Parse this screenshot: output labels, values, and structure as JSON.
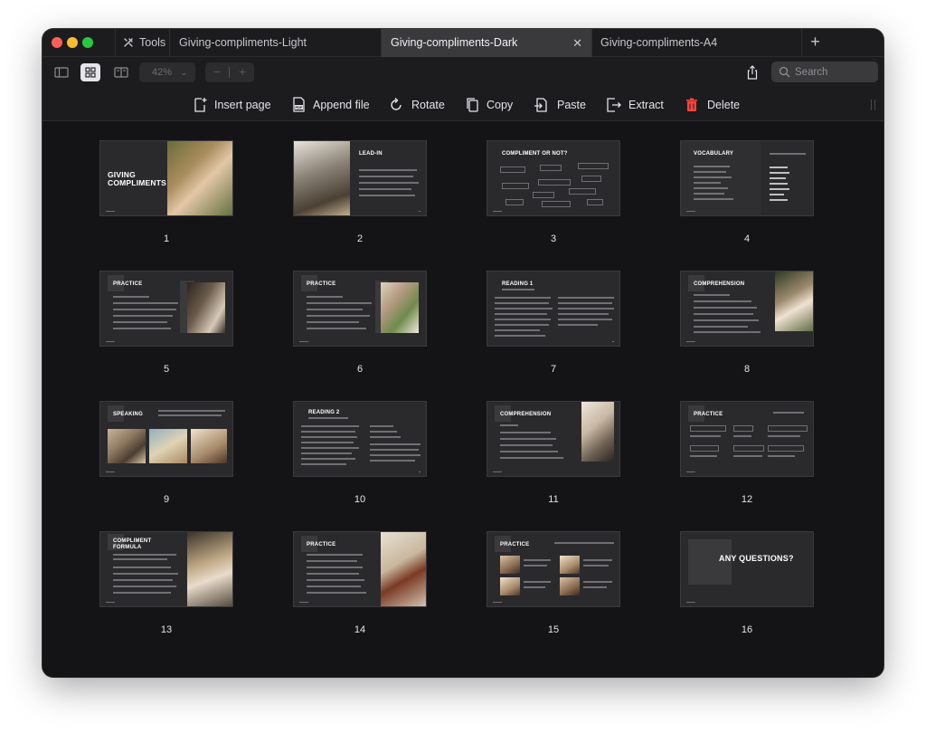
{
  "tabs": {
    "tools_label": "Tools",
    "open": [
      {
        "title": "Giving-compliments-Light",
        "active": false
      },
      {
        "title": "Giving-compliments-Dark",
        "active": true
      },
      {
        "title": "Giving-compliments-A4",
        "active": false
      }
    ],
    "close_glyph": "✕",
    "new_tab_glyph": "+"
  },
  "toolbar": {
    "zoom_value": "42%",
    "zoom_minus": "−",
    "zoom_plus": "+",
    "search_placeholder": "Search"
  },
  "actions": {
    "insert_page": "Insert page",
    "append_file": "Append file",
    "rotate": "Rotate",
    "copy": "Copy",
    "paste": "Paste",
    "extract": "Extract",
    "delete": "Delete"
  },
  "pages": [
    {
      "number": "1",
      "title": "GIVING COMPLIMENTS"
    },
    {
      "number": "2",
      "title": "LEAD-IN"
    },
    {
      "number": "3",
      "title": "COMPLIMENT OR NOT?"
    },
    {
      "number": "4",
      "title": "VOCABULARY"
    },
    {
      "number": "5",
      "title": "PRACTICE"
    },
    {
      "number": "6",
      "title": "PRACTICE"
    },
    {
      "number": "7",
      "title": "READING 1"
    },
    {
      "number": "8",
      "title": "COMPREHENSION"
    },
    {
      "number": "9",
      "title": "SPEAKING"
    },
    {
      "number": "10",
      "title": "READING 2"
    },
    {
      "number": "11",
      "title": "COMPREHENSION"
    },
    {
      "number": "12",
      "title": "PRACTICE"
    },
    {
      "number": "13",
      "title": "COMPLIMENT FORMULA"
    },
    {
      "number": "14",
      "title": "PRACTICE"
    },
    {
      "number": "15",
      "title": "PRACTICE"
    },
    {
      "number": "16",
      "title": "ANY QUESTIONS?"
    }
  ],
  "colors": {
    "window_bg": "#141416",
    "chrome_bg": "#1c1c1e",
    "active_tab": "#3a3a3c",
    "slide_bg": "#2a2a2c",
    "delete_red": "#ff453a"
  }
}
